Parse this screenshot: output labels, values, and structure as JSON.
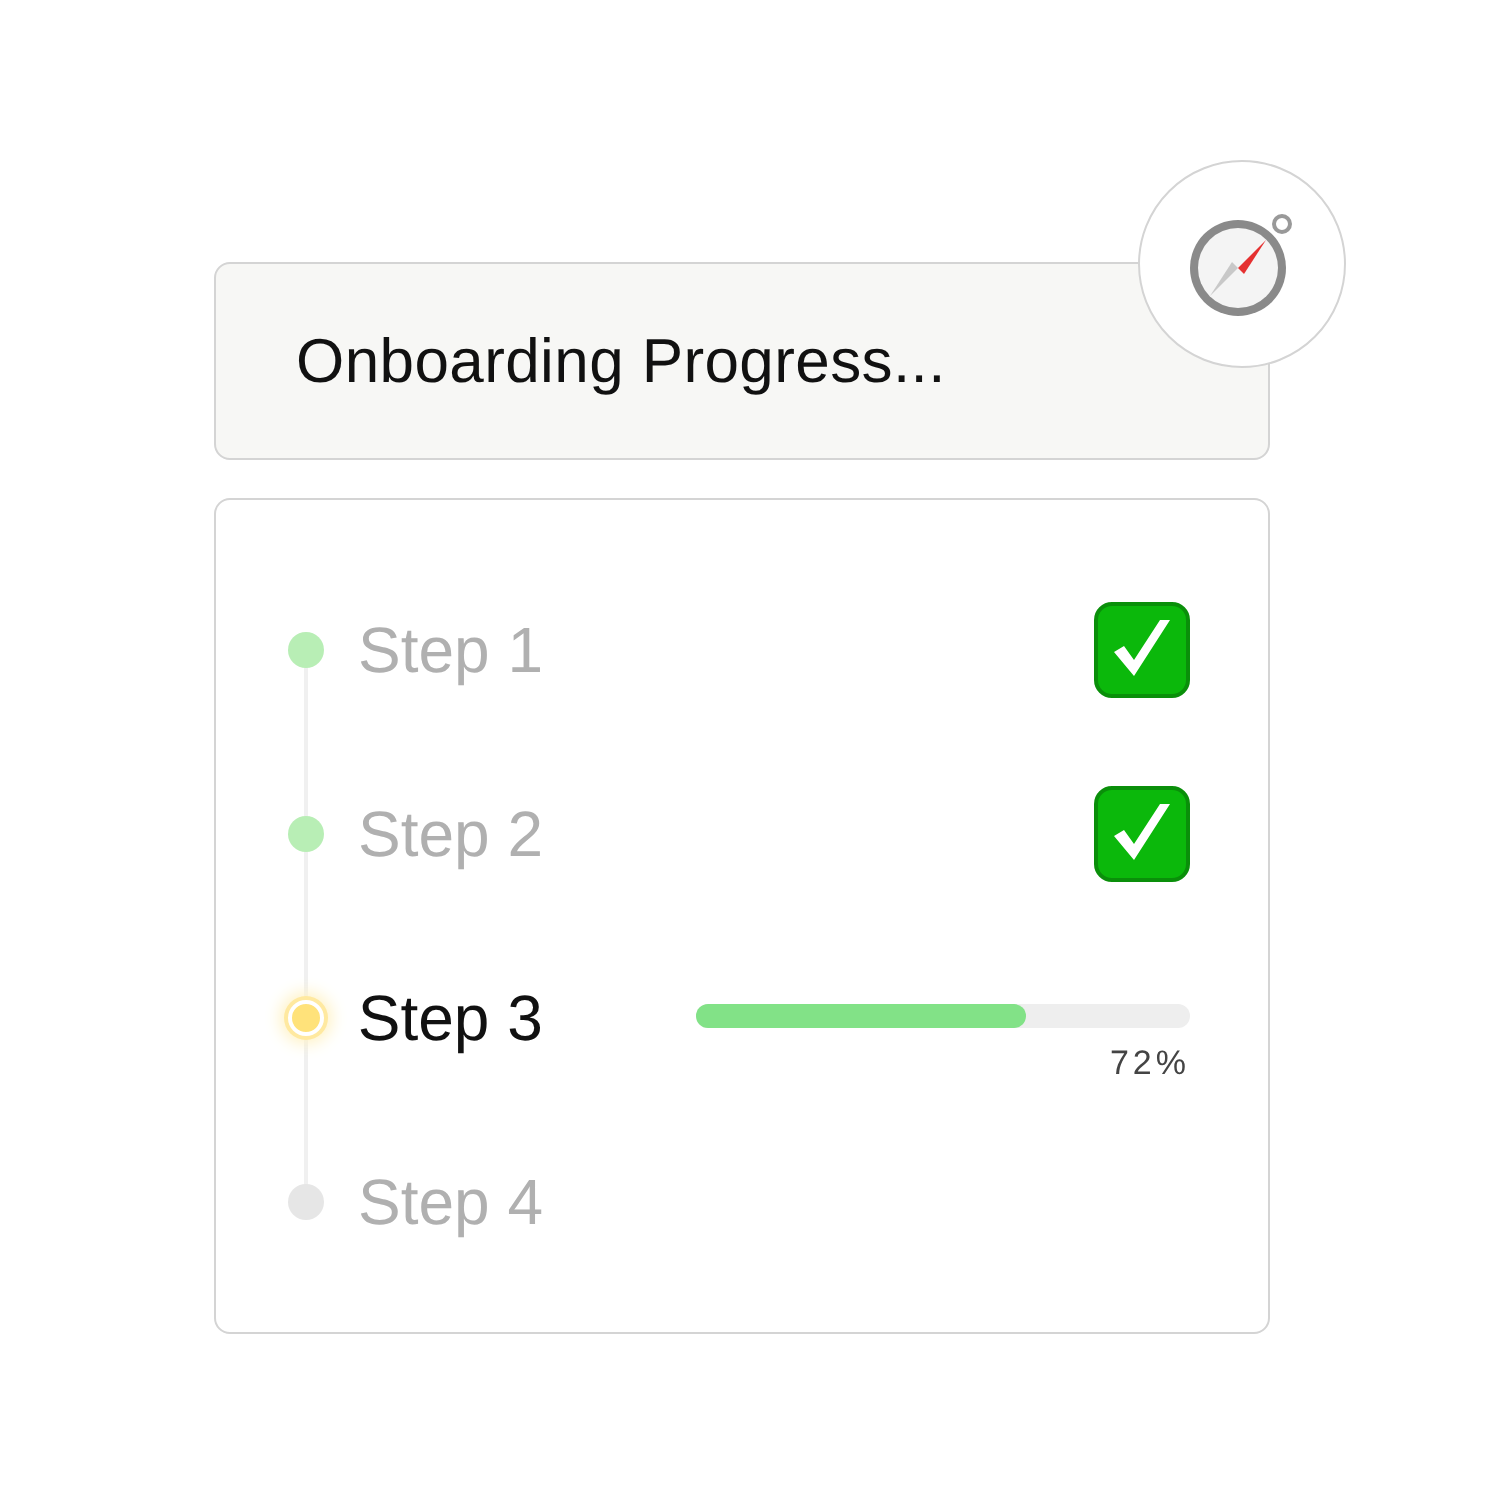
{
  "header": {
    "title": "Onboarding Progress..."
  },
  "steps": [
    {
      "label": "Step 1",
      "kind": "done"
    },
    {
      "label": "Step 2",
      "kind": "done"
    },
    {
      "label": "Step 3",
      "kind": "current",
      "level": 0.67,
      "reading": "72%"
    },
    {
      "label": "Step 4",
      "kind": "pending"
    }
  ]
}
